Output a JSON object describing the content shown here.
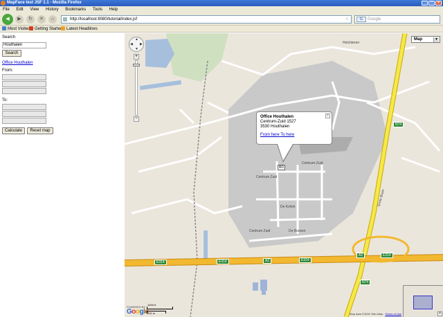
{
  "window": {
    "title": "MapFace test JSF 1.1 - Mozilla Firefox",
    "minimize": "_",
    "maximize": "□",
    "close": "x"
  },
  "menu": [
    "File",
    "Edit",
    "View",
    "History",
    "Bookmarks",
    "Tools",
    "Help"
  ],
  "nav": {
    "url": "http://localhost:8080/tutorial/index.jsf",
    "search_placeholder": "Google",
    "search_engine_label": "G"
  },
  "bookmarks": [
    "Most Visited",
    "Getting Started",
    "Latest Headlines"
  ],
  "panel": {
    "search_label": "Search",
    "search_value": "Houthalen",
    "search_button": "Search",
    "result_link": "Office Houthalen",
    "from_label": "From:",
    "to_label": "To:",
    "calculate_button": "Calculate",
    "reset_button": "Reset map"
  },
  "map": {
    "type_selector": "Map",
    "zoom_in": "+",
    "zoom_out": "−",
    "bubble": {
      "title": "Office Houthalen",
      "line1": "Centrum-Zuid 1527",
      "line2": "3530 Houthalen",
      "from_here": "From here",
      "to_here": "To here",
      "close": "x"
    },
    "marker_label": "BD",
    "labels": {
      "helchteren": "Helchteren",
      "centrum_zuid_a": "Centrum-Zuid",
      "centrum_zuid_b": "Centrum Zuid",
      "centrum_zuid_c": "Centrum Zuid",
      "de_kolvin": "De Kolvin",
      "de_bocken": "De Bocken",
      "grote_baan": "Grote Baan"
    },
    "shields": [
      "E314",
      "E314",
      "A2",
      "E314",
      "A2",
      "N74",
      "E314",
      "N74"
    ],
    "powered_by": "POWERED BY",
    "google_logo": [
      "G",
      "o",
      "o",
      "g",
      "l",
      "e"
    ],
    "scale_top": "1000 ft",
    "scale_bottom": "200 m",
    "copyright": "Map data ©2009 Tele Atlas -",
    "terms": "Terms of Use",
    "overview_toggle": "x",
    "colors": {
      "land": "#ebe6dc",
      "industrial": "#c9c9c9",
      "motorway": "#f2b830",
      "highway": "#f5e84a",
      "water": "#a6bfdd",
      "park": "#cfe0c0"
    }
  }
}
